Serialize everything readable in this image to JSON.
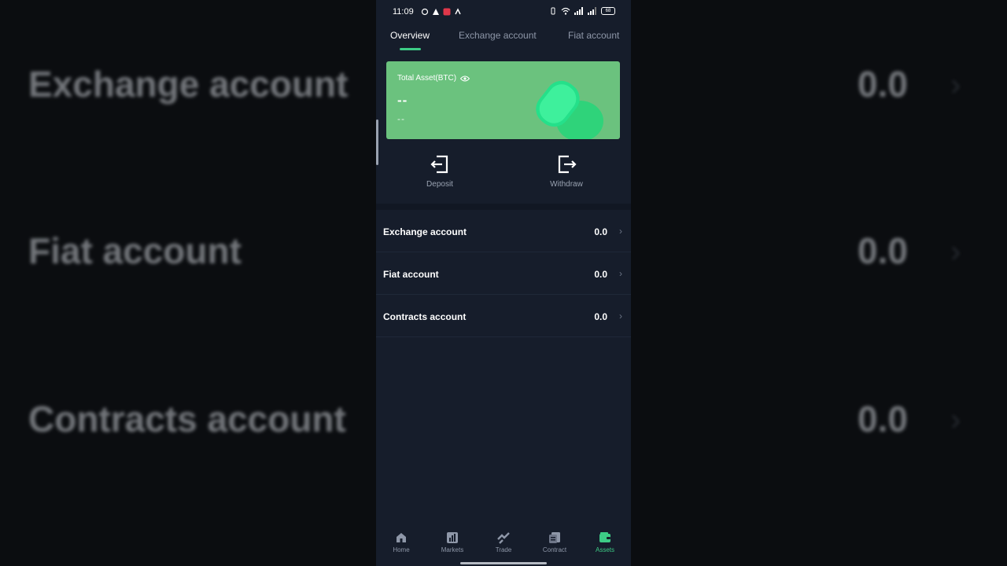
{
  "background": {
    "rows": [
      {
        "name": "Exchange account",
        "value": "0.0"
      },
      {
        "name": "Fiat account",
        "value": "0.0"
      },
      {
        "name": "Contracts account",
        "value": "0.0"
      }
    ]
  },
  "status_bar": {
    "time": "11:09",
    "battery": "68"
  },
  "tabs": [
    {
      "label": "Overview",
      "active": true
    },
    {
      "label": "Exchange account",
      "active": false
    },
    {
      "label": "Fiat account",
      "active": false
    }
  ],
  "asset_card": {
    "label": "Total Asset(BTC)",
    "main_value": "--",
    "sub_value": "--",
    "icon": "eye-icon",
    "color": "#6bc27e"
  },
  "actions": [
    {
      "label": "Deposit",
      "icon": "deposit-icon"
    },
    {
      "label": "Withdraw",
      "icon": "withdraw-icon"
    }
  ],
  "accounts": [
    {
      "name": "Exchange account",
      "value": "0.0"
    },
    {
      "name": "Fiat account",
      "value": "0.0"
    },
    {
      "name": "Contracts account",
      "value": "0.0"
    }
  ],
  "bottom_nav": [
    {
      "label": "Home",
      "icon": "home-icon",
      "active": false
    },
    {
      "label": "Markets",
      "icon": "markets-icon",
      "active": false
    },
    {
      "label": "Trade",
      "icon": "trade-icon",
      "active": false
    },
    {
      "label": "Contract",
      "icon": "contract-icon",
      "active": false
    },
    {
      "label": "Assets",
      "icon": "assets-icon",
      "active": true
    }
  ],
  "colors": {
    "accent": "#3dcc86",
    "background": "#161d2b"
  }
}
